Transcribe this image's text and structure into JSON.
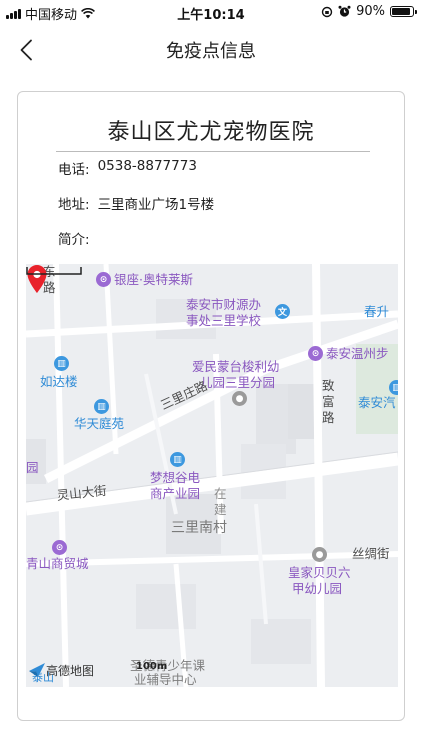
{
  "status_bar": {
    "carrier": "中国移动",
    "time": "上午10:14",
    "battery_text": "90%",
    "battery_level": 0.9
  },
  "nav": {
    "title": "免疫点信息",
    "back_icon": "chevron-left-icon"
  },
  "card": {
    "name": "泰山区尤尤宠物医院",
    "phone_label": "电话:",
    "phone": "0538-8877773",
    "address_label": "地址:",
    "address": "三里商业广场1号楼",
    "intro_label": "简介:",
    "intro": ""
  },
  "map": {
    "pois": {
      "yinzuo": "银座·奥特莱斯",
      "caiyuan_1": "泰安市财源办",
      "caiyuan_2": "事处三里学校",
      "chunsheng": "春升",
      "wenzhou": "泰安温州步",
      "ruda": "如达楼",
      "aimin_1": "爱民蒙台梭利幼",
      "aimin_2": "儿园三里分园",
      "taian_qi": "泰安汽",
      "huatian": "华天庭苑",
      "mengxiang_1": "梦想谷电",
      "mengxiang_2": "商产业园",
      "qingshan": "青山商贸城",
      "huangjia_1": "皇家贝贝六",
      "huangjia_2": "甲幼儿园",
      "shengde_1": "圣德青少年课",
      "shengde_2": "业辅导中心",
      "yuan": "园",
      "taishan_di": "泰山"
    },
    "roads": {
      "dong_road_1": "东",
      "dong_road_2": "路",
      "sanli_zhuang": "三里庄路",
      "zhifu_1": "致",
      "zhifu_2": "富",
      "zhifu_3": "路",
      "lingshan": "灵山大街",
      "sichou": "丝绸街",
      "zaijian_1": "在",
      "zaijian_2": "建"
    },
    "areas": {
      "sanli_nancun": "三里南村"
    },
    "logo": "高德地图",
    "scale": "100m",
    "marker_color": "#e8222b"
  }
}
